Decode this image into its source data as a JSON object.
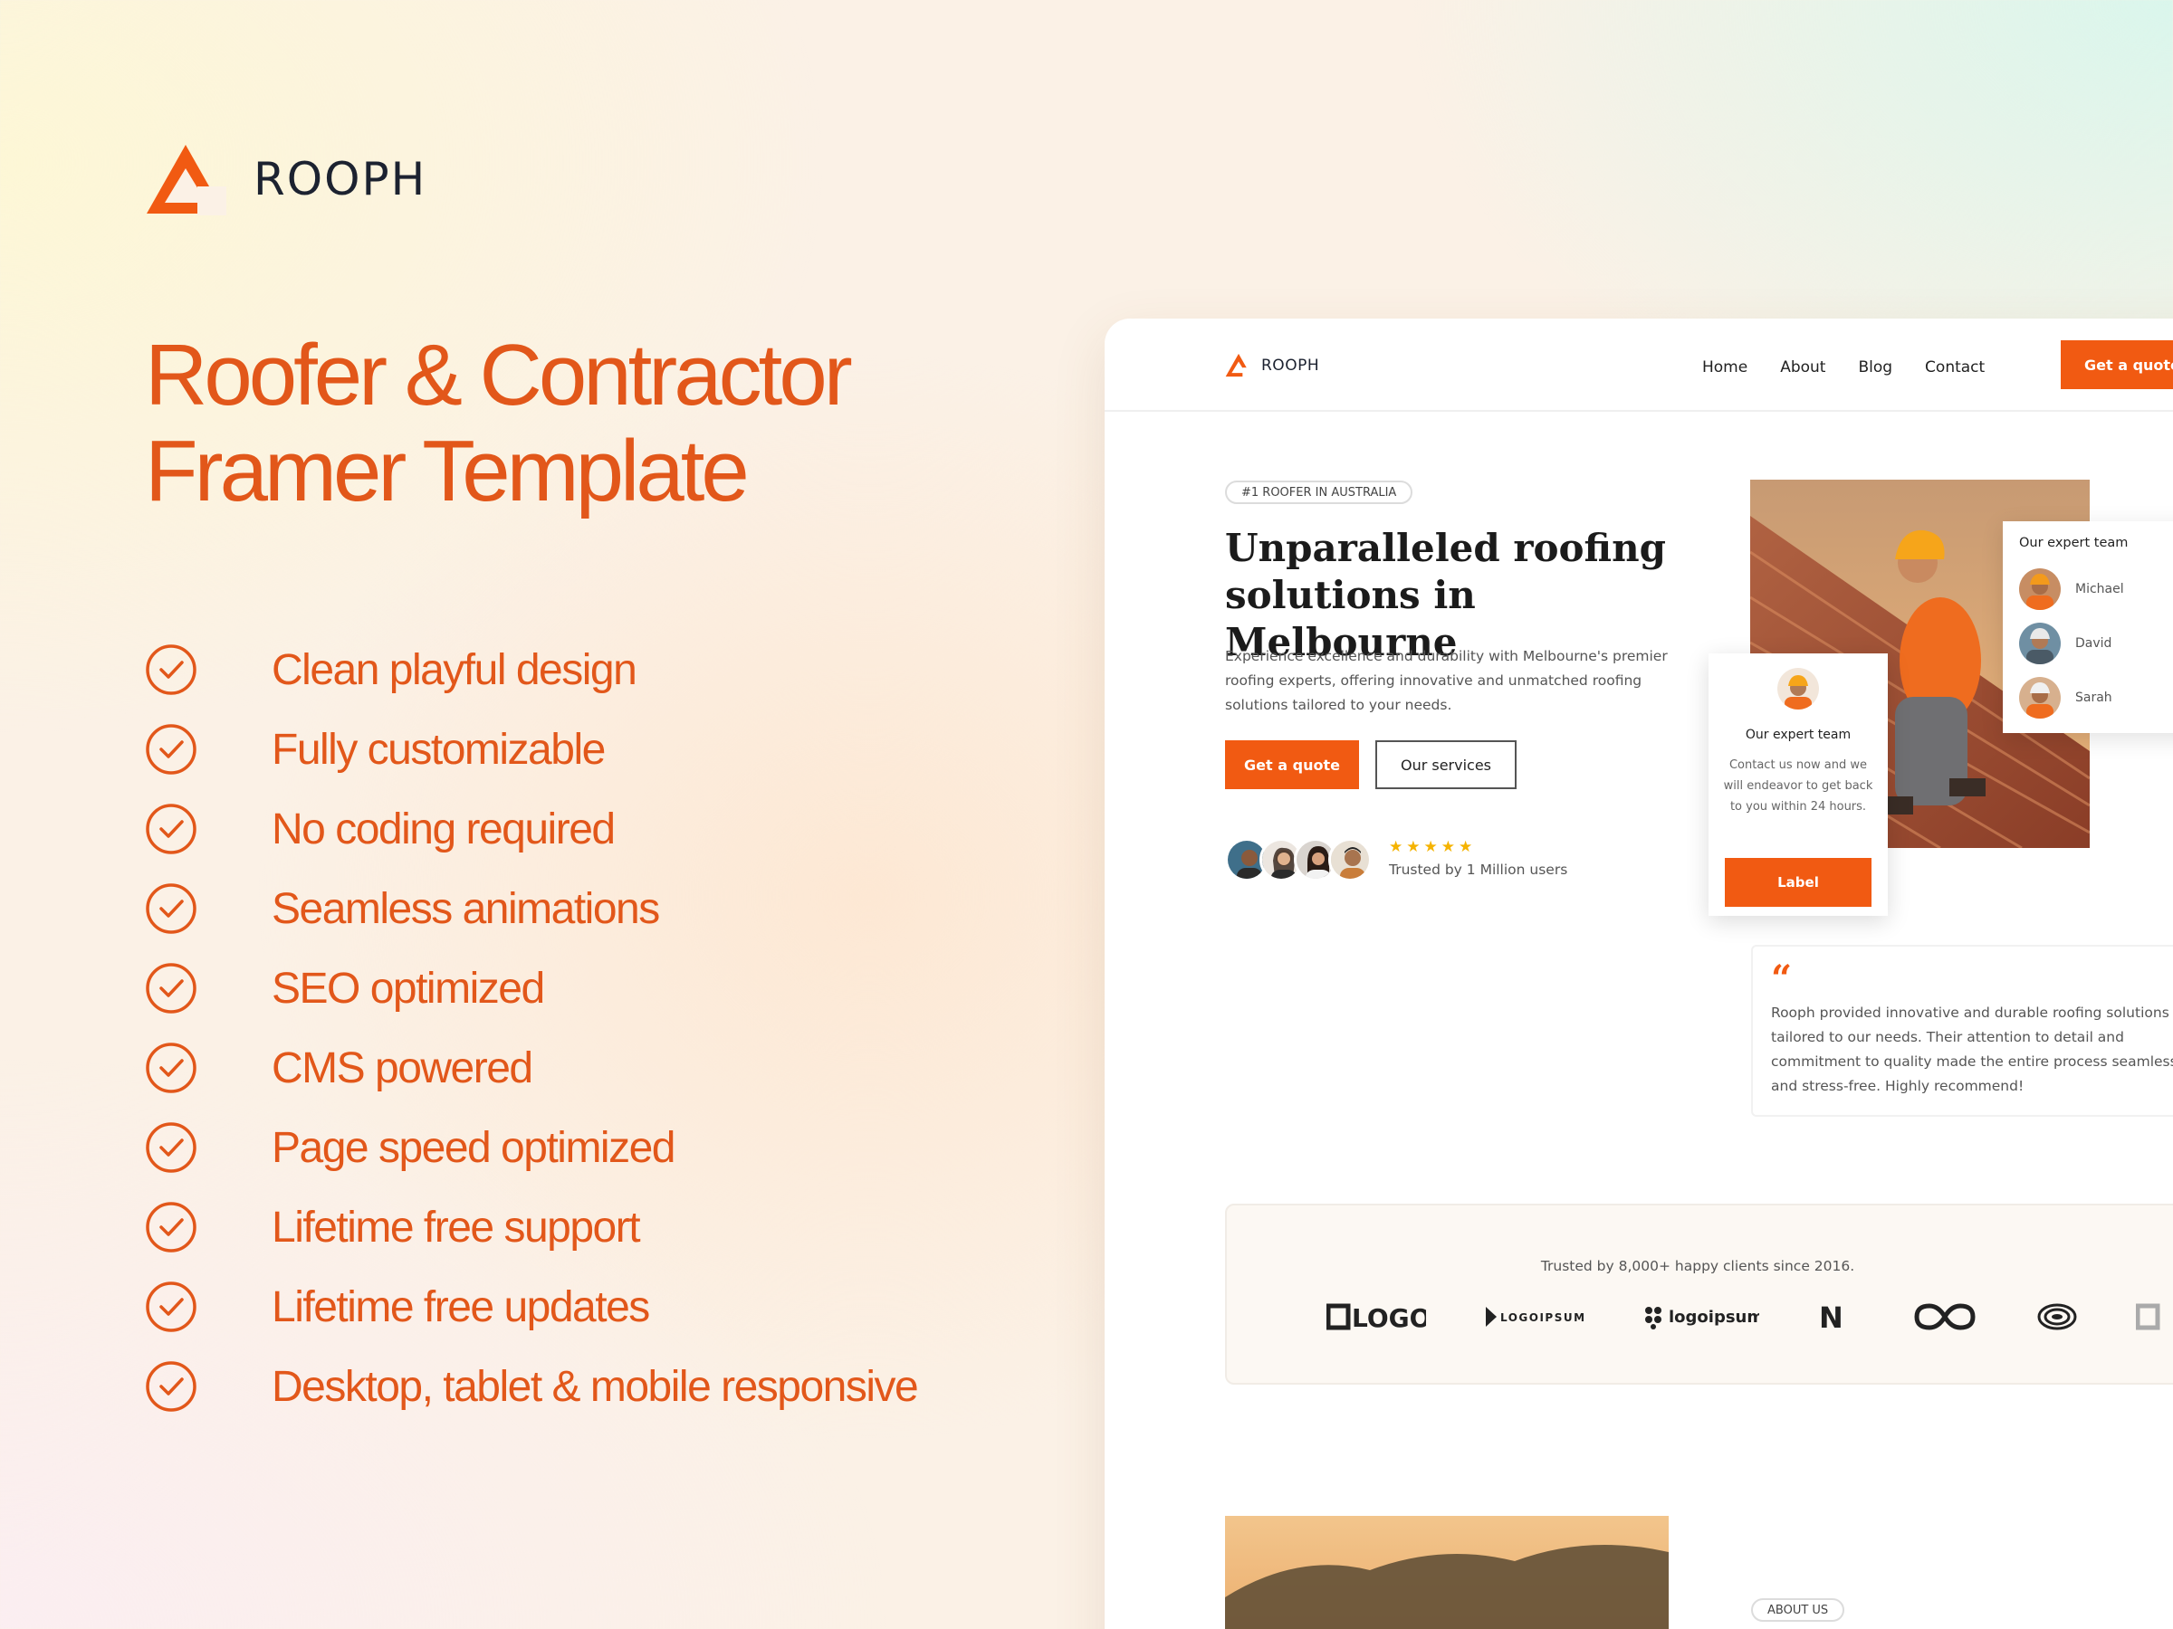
{
  "promo": {
    "brand_name": "ROOPH",
    "headline_line1": "Roofer & Contractor",
    "headline_line2": "Framer Template",
    "features": [
      "Clean playful design",
      "Fully customizable",
      "No coding required",
      "Seamless animations",
      "SEO optimized",
      "CMS powered",
      "Page speed optimized",
      "Lifetime free support",
      "Lifetime free updates",
      "Desktop, tablet & mobile responsive"
    ],
    "accent_color": "#e2571a",
    "check_icon": "check-circle-icon"
  },
  "mockup": {
    "nav": {
      "brand": "ROOPH",
      "links": [
        "Home",
        "About",
        "Blog",
        "Contact"
      ],
      "cta": "Get a quote"
    },
    "hero": {
      "badge": "#1 ROOFER IN AUSTRALIA",
      "title_line1": "Unparalleled roofing",
      "title_line2": "solutions in Melbourne",
      "description": "Experience excellence and durability with Melbourne's premier roofing experts, offering innovative and unmatched roofing solutions tailored to your needs.",
      "primary_button": "Get a quote",
      "secondary_button": "Our services",
      "stars": "★★★★★",
      "trusted_text": "Trusted by 1 Million users"
    },
    "team_card": {
      "title": "Our expert team",
      "members": [
        "Michael",
        "David",
        "Sarah"
      ]
    },
    "contact_card": {
      "title": "Our expert team",
      "text": "Contact us now and we will endeavor to get back to you within 24 hours.",
      "button": "Label"
    },
    "testimonial": {
      "quote_mark": "“",
      "text": "Rooph provided innovative and durable roofing solutions tailored to our needs. Their attention to detail and commitment to quality made the entire process seamless and stress-free. Highly recommend!"
    },
    "clients": {
      "title": "Trusted by 8,000+ happy clients since 2016.",
      "logos": [
        "LOGO",
        "LOGOIPSUM",
        "logoipsum",
        "N",
        "infinity-logo",
        "ring-logo",
        "partial-logo"
      ]
    },
    "about_badge": "ABOUT US",
    "primary_color": "#f15a12"
  }
}
